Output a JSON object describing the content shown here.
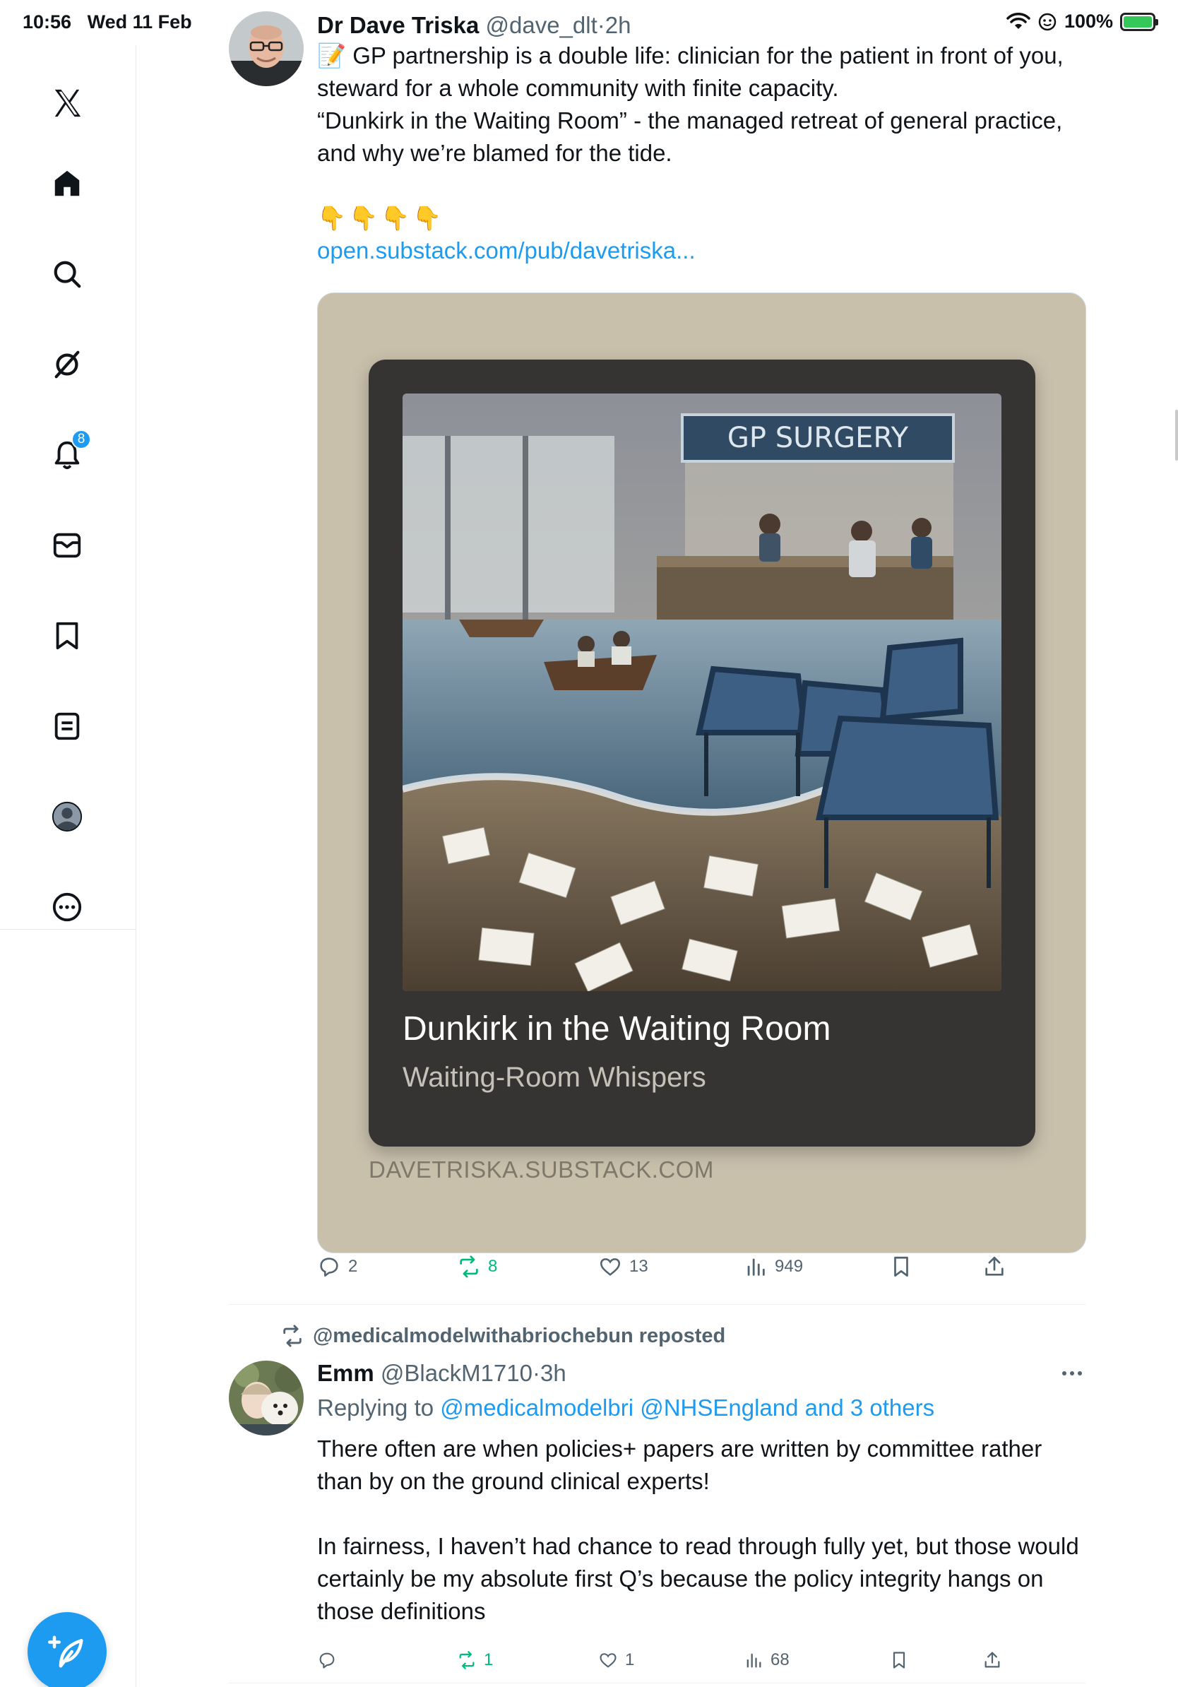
{
  "status_bar": {
    "time": "10:56",
    "date": "Wed 11 Feb",
    "battery": "100%",
    "battery_level": 1.0,
    "icons": [
      "wifi-icon",
      "focus-icon",
      "battery-charging-icon"
    ]
  },
  "sidebar": {
    "items": [
      {
        "name": "x-logo",
        "icon": "x-logo-icon"
      },
      {
        "name": "home",
        "icon": "home-icon"
      },
      {
        "name": "explore",
        "icon": "search-icon"
      },
      {
        "name": "grok",
        "icon": "grok-icon"
      },
      {
        "name": "notifications",
        "icon": "bell-icon",
        "badge": "8"
      },
      {
        "name": "messages",
        "icon": "envelope-icon"
      },
      {
        "name": "bookmarks",
        "icon": "bookmark-icon"
      },
      {
        "name": "lists",
        "icon": "list-icon"
      },
      {
        "name": "profile",
        "icon": "profile-icon"
      },
      {
        "name": "more",
        "icon": "more-circle-icon"
      }
    ],
    "compose_icon": "compose-feather-icon"
  },
  "tweet1": {
    "display_name": "Dr Dave Triska",
    "handle": "@dave_dlt",
    "separator": "·",
    "time": "2h",
    "text_line1": "📝 GP partnership is a double life: clinician for the patient in front of you, steward for a whole community with finite capacity.",
    "text_line2": "“Dunkirk in the Waiting Room” - the managed retreat of general practice, and why we’re blamed for the tide.",
    "emoji_line": "👇👇👇👇",
    "link": "open.substack.com/pub/davetriska...",
    "card": {
      "image_sign": "GP SURGERY",
      "title": "Dunkirk in the Waiting Room",
      "subtitle": "Waiting-Room Whispers",
      "domain": "DAVETRISKA.SUBSTACK.COM"
    },
    "actions": {
      "replies": "2",
      "reposts": "8",
      "likes": "13",
      "views": "949"
    },
    "reposted_by_me": true
  },
  "tweet2": {
    "repost_label": "@medicalmodelwithabriochebun reposted",
    "display_name": "Emm",
    "handle": "@BlackM1710",
    "separator": "·",
    "time": "3h",
    "replying_prefix": "Replying to ",
    "replying_users": "@medicalmodelbri @NHSEngland and 3 others",
    "text_para1": "There often are when policies+ papers are written by committee rather than by on the ground clinical experts!",
    "text_para2": "In fairness, I haven’t had chance to read through fully yet, but those would certainly be my absolute first Q’s because the policy integrity hangs on those definitions",
    "actions": {
      "replies": "",
      "reposts": "1",
      "likes": "1",
      "views": "68"
    },
    "reposted_by_me": true
  }
}
